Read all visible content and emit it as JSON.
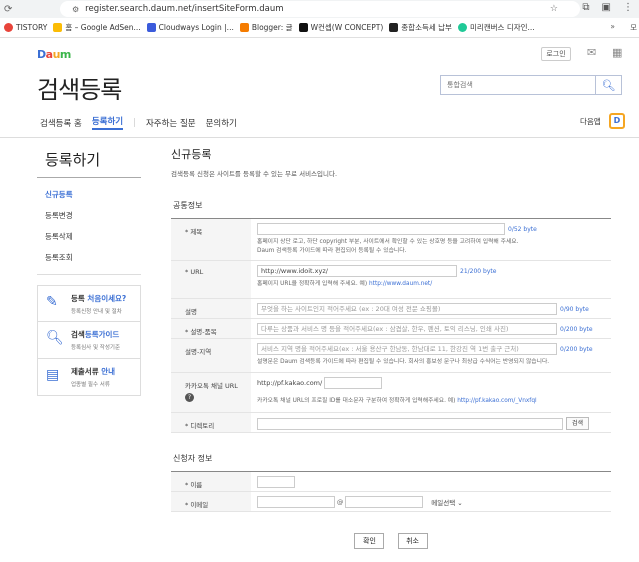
{
  "browser": {
    "url": "register.search.daum.net/insertSiteForm.daum",
    "bookmarks": [
      {
        "label": "TISTORY",
        "color": "#e8443a"
      },
      {
        "label": "홈 – Google AdSen...",
        "color": "#fbbc05"
      },
      {
        "label": "Cloudways Login |...",
        "color": "#3b5bdb"
      },
      {
        "label": "Blogger: 글",
        "color": "#f57c00"
      },
      {
        "label": "W컨셉(W CONCEPT)",
        "color": "#111111"
      },
      {
        "label": "종합소득세 납부",
        "color": "#222222"
      },
      {
        "label": "미리캔버스 디자인...",
        "color": "#20c997"
      }
    ],
    "more_label": "»",
    "folder_label": "모"
  },
  "header": {
    "logo": [
      "D",
      "a",
      "u",
      "m"
    ],
    "login_label": "로그인",
    "page_title": "검색등록",
    "search_placeholder": "통합검색"
  },
  "gnb": {
    "items": [
      "검색등록 홈",
      "등록하기",
      "자주하는 질문",
      "문의하기"
    ],
    "app_label": "다음앱",
    "app_icon": "D"
  },
  "lnb": {
    "title": "등록하기",
    "items": [
      "신규등록",
      "등록변경",
      "등록삭제",
      "등록조회"
    ],
    "promos": [
      {
        "pre": "등록 ",
        "hl": "처음이세요?",
        "sub": "등록신청 안내 및 절차"
      },
      {
        "pre": "검색",
        "hl": "등록가이드",
        "sub": "등록심사 및 작성기준"
      },
      {
        "pre": "제출서류 ",
        "hl": "안내",
        "sub": "업종별 필수 서류"
      }
    ]
  },
  "main": {
    "title": "신규등록",
    "desc": "검색등록 신청은 사이트를 등록할 수 있는 무료 서비스입니다.",
    "section1": "공통정보",
    "fields": {
      "title_label": "* 제목",
      "title_count": "0/52 byte",
      "title_hint1": "홈페이지 상단 로고, 하단 copyright 부분, 사이트에서 확인할 수 있는 상호명 등을 고려하여 입력해 주세요.",
      "title_hint2": "Daum 검색등록 가이드에 따라 편집되어 등록될 수 있습니다.",
      "url_label": "* URL",
      "url_value": "http://www.idoit.xyz/",
      "url_count": "21/200 byte",
      "url_hint_pre": "홈페이지 URL을 정확하게 입력해 주세요. 예) ",
      "url_hint_link": "http://www.daum.net/",
      "desc_label": "설명",
      "desc_placeholder": "무엇을 하는 사이트인지 적어주세요 (ex : 20대 여성 전문 쇼핑몰)",
      "desc_count": "0/90 byte",
      "item_label": "* 설명-품목",
      "item_placeholder": "다루는 상품과 서비스 명 등을 적어주세요(ex : 삼겹살, 한우, 펜션, 토익 리스닝, 인쇄 사진)",
      "item_count": "0/200 byte",
      "region_label": "설명-지역",
      "region_placeholder": "서비스 지역 명을 적어주세요(ex : 서울 용산구 한남동, 한남대로 11, 한강진 역 1번 출구 근처)",
      "region_count": "0/200 byte",
      "region_hint": "설명문은 Daum 검색등록 가이드에 따라 편집될 수 있습니다. 회사의 홍보성 문구나 최상급 수식어는 반영되지 않습니다.",
      "kakao_label": "카카오톡 채널 URL",
      "kakao_prefix": "http://pf.kakao.com/",
      "kakao_help": "?",
      "kakao_hint_pre": "카카오톡 채널 URL의 프로필 ID를 대소문자 구분하여 정확하게 입력해주세요. 예) ",
      "kakao_hint_link": "http://pf.kakao.com/_Vnxfql",
      "dir_label": "* 디렉토리",
      "dir_button": "검색"
    },
    "section2": "신청자 정보",
    "applicant": {
      "name_label": "* 이름",
      "email_label": "* 이메일",
      "email_at": "@",
      "email_select": "메일선택"
    },
    "confirm_label": "확인",
    "cancel_label": "취소"
  }
}
